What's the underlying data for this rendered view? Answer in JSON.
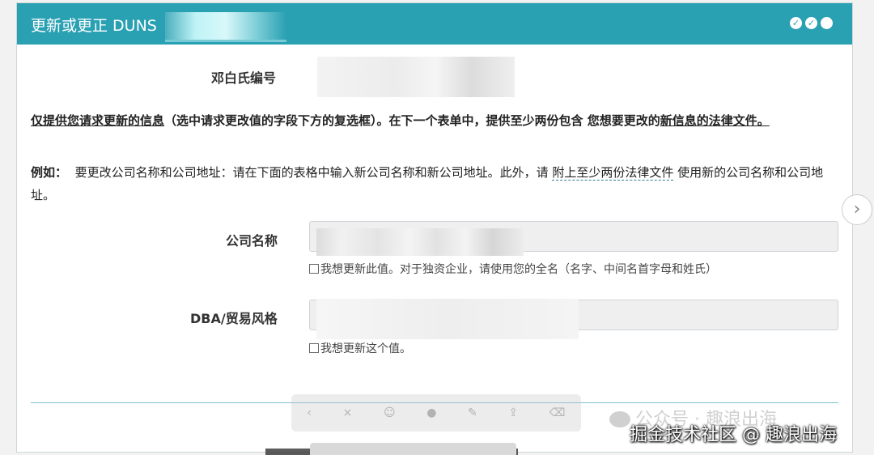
{
  "header": {
    "title": "更新或更正 DUNS",
    "window_controls": [
      "check-icon",
      "check-icon",
      "circle-icon"
    ]
  },
  "duns_row": {
    "label": "邓白氏编号"
  },
  "instruction": {
    "part1": "仅提供您请求更新的信息",
    "part2": "（选中请求更改值的字段下方的复选框）。在下一个表单中，提供至少两份包含 您想要更改的",
    "part3": "新信息的法律文件。"
  },
  "example": {
    "prefix": "例如：",
    "text1": "要更改公司名称和公司地址：请在下面的表格中输入新公司名称和新公司地址。此外，请",
    "link": "附上至少两份法律文件",
    "text2": "使用新的公司名称和公司地址。"
  },
  "company_name": {
    "label": "公司名称",
    "checkbox_text": "我想更新此值。对于独资企业，请使用您的全名（名字、中间名首字母和姓氏）"
  },
  "dba": {
    "label": "DBA/贸易风格",
    "checkbox_text": "我想更新这个值。"
  },
  "watermark": {
    "line1": "公众号 · 趣浪出海",
    "line2": "掘金技术社区 @ 趣浪出海"
  },
  "icons": {
    "next": "chevron-right-icon"
  }
}
